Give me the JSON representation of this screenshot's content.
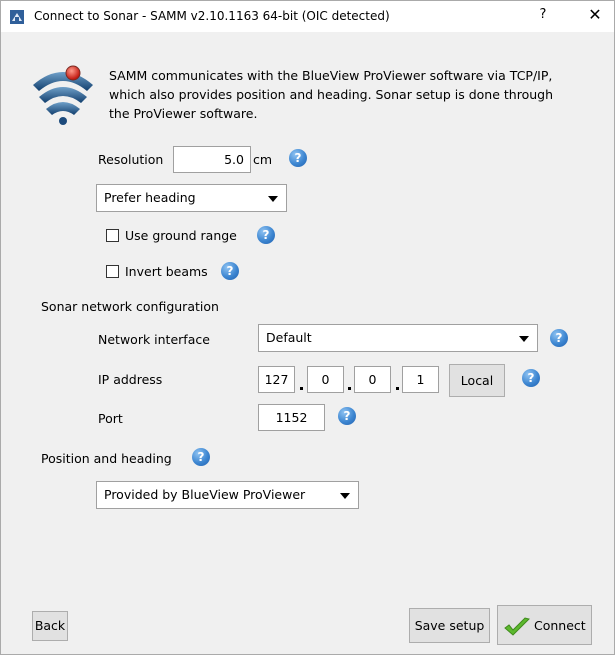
{
  "window": {
    "title": "Connect to Sonar - SAMM v2.10.1163 64-bit (OIC detected)",
    "help_glyph": "?",
    "close_glyph": "✕",
    "app_icon": "samm-app-icon"
  },
  "intro": {
    "icon": "sonar-signal-icon",
    "line1": "SAMM communicates with the BlueView ProViewer software via TCP/IP,",
    "line2": "which also provides position and heading.  Sonar setup is done through",
    "line3": "the ProViewer software."
  },
  "resolution": {
    "label": "Resolution",
    "value": "5.0",
    "unit": "cm"
  },
  "heading_mode": {
    "selected": "Prefer heading"
  },
  "options": {
    "use_ground_range_label": "Use ground range",
    "use_ground_range_checked": false,
    "invert_beams_label": "Invert beams",
    "invert_beams_checked": false
  },
  "network": {
    "section_label": "Sonar network configuration",
    "interface_label": "Network interface",
    "interface_selected": "Default",
    "ip_label": "IP address",
    "ip_octets": [
      "127",
      "0",
      "0",
      "1"
    ],
    "local_button": "Local",
    "port_label": "Port",
    "port_value": "1152"
  },
  "position": {
    "section_label": "Position and heading",
    "selected": "Provided by BlueView ProViewer"
  },
  "help_glyph": "?",
  "footer": {
    "back_label": "Back",
    "save_label": "Save setup",
    "connect_label": "Connect"
  },
  "colors": {
    "window_bg": "#f0f0f0",
    "help_icon": "#3d86d1",
    "connect_check": "#5cb82e"
  }
}
